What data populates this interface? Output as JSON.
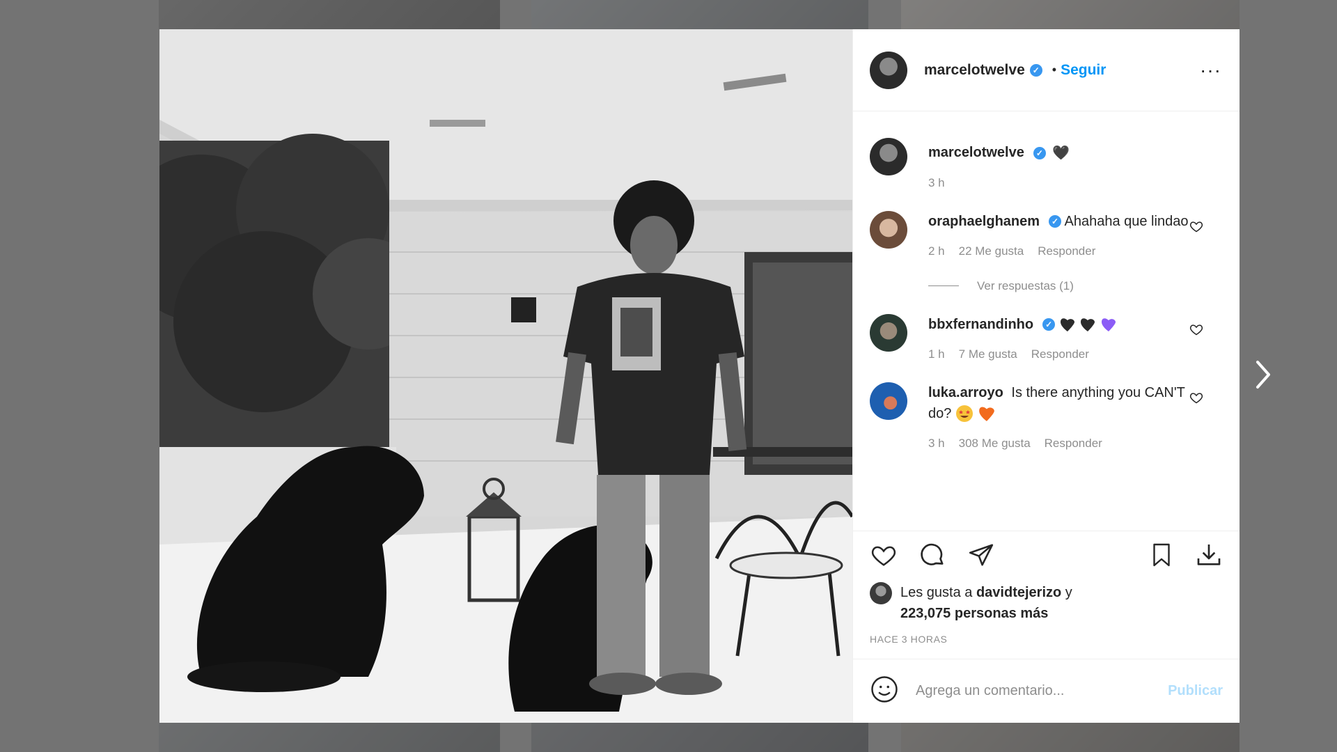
{
  "post": {
    "author": "marcelotwelve",
    "follow_label": "Seguir",
    "separator": "•",
    "more_label": "···"
  },
  "comments": [
    {
      "user": "marcelotwelve",
      "text": "",
      "emoji": "🖤",
      "time": "3 h"
    },
    {
      "user": "oraphaelghanem",
      "text": "Ahahaha que lindao",
      "time": "2 h",
      "likes": "22 Me gusta",
      "reply": "Responder"
    },
    {
      "user": "bbxfernandinho",
      "text": "",
      "time": "1 h",
      "likes": "7 Me gusta",
      "reply": "Responder"
    },
    {
      "user": "luka.arroyo",
      "text": "Is there anything you CAN'T do?",
      "time": "3 h",
      "likes": "308 Me gusta",
      "reply": "Responder"
    }
  ],
  "view_replies": "Ver respuestas (1)",
  "likes_summary": {
    "prefix": "Les gusta a ",
    "user": "davidtejerizo",
    "joiner": " y",
    "count": "223,075 personas más"
  },
  "time_ago": "HACE 3 HORAS",
  "comment_box": {
    "placeholder": "Agrega un comentario...",
    "publish": "Publicar"
  },
  "colors": {
    "accent": "#0095f6",
    "verified": "#3897f0",
    "muted": "#8e8e8e"
  },
  "icons": [
    "heart-icon",
    "comment-icon",
    "share-icon",
    "bookmark-icon",
    "download-icon",
    "emoji-icon",
    "more-icon",
    "chevron-right-icon"
  ]
}
